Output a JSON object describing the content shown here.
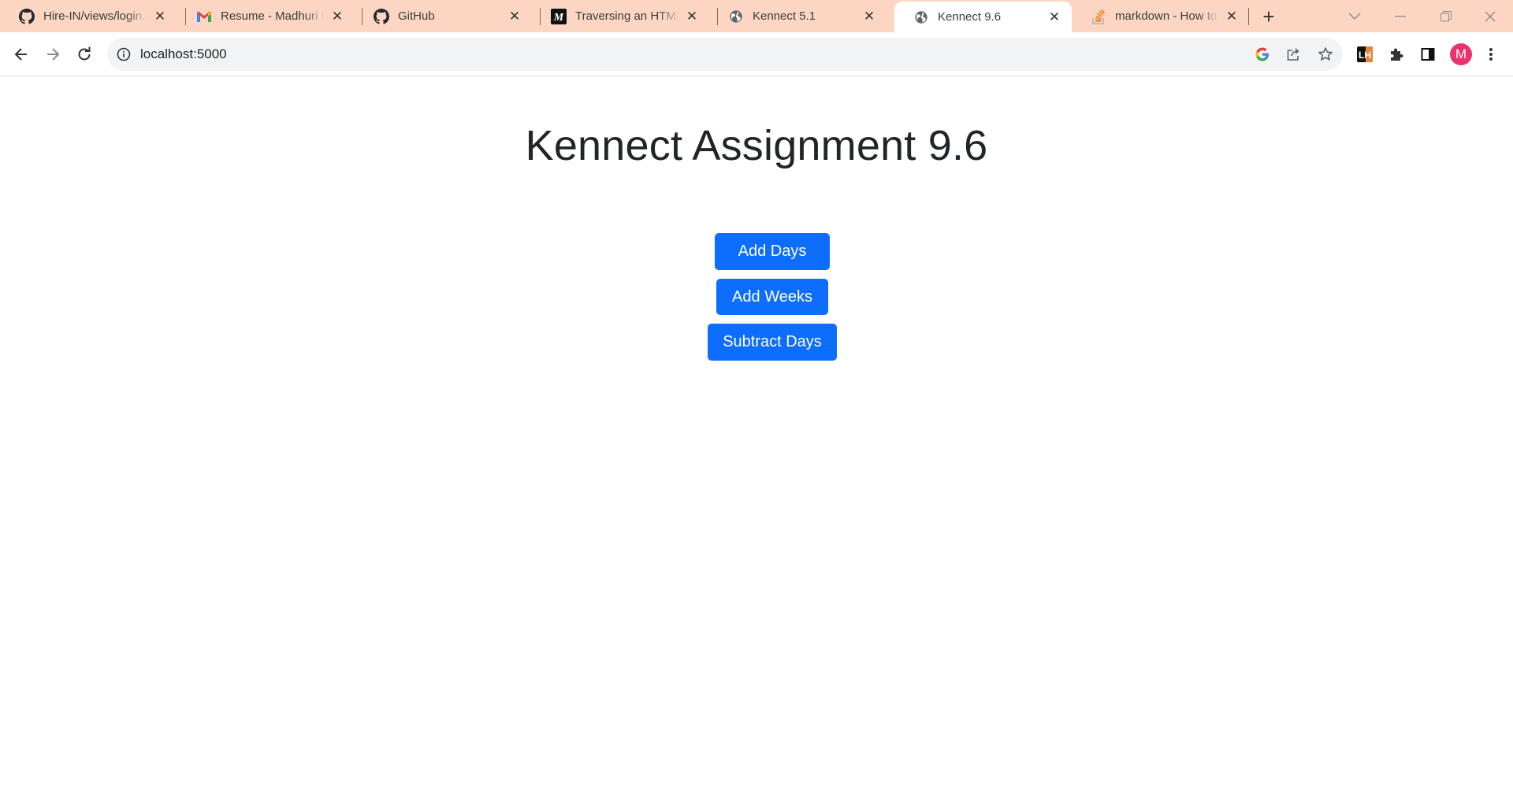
{
  "browser": {
    "tabs": [
      {
        "title": "Hire-IN/views/login.ejs",
        "favicon": "github-icon",
        "active": false
      },
      {
        "title": "Resume - Madhuri Ra",
        "favicon": "gmail-icon",
        "active": false
      },
      {
        "title": "GitHub",
        "favicon": "github-icon",
        "active": false
      },
      {
        "title": "Traversing an HTML ta",
        "favicon": "medium-icon",
        "active": false
      },
      {
        "title": "Kennect 5.1",
        "favicon": "globe-icon",
        "active": false
      },
      {
        "title": "Kennect 9.6",
        "favicon": "globe-icon",
        "active": true
      },
      {
        "title": "markdown - How to a",
        "favicon": "stackoverflow-icon",
        "active": false
      }
    ],
    "address_bar": {
      "url": "localhost:5000"
    },
    "profile_initial": "M",
    "extension_label": "LH",
    "colors": {
      "tabstrip": "#fcd6c3",
      "profile": "#e8336d"
    }
  },
  "page": {
    "title": "Kennect Assignment 9.6",
    "buttons": {
      "add_days": "Add Days",
      "add_weeks": "Add Weeks",
      "subtract_days": "Subtract Days"
    },
    "colors": {
      "button": "#0d6efd",
      "heading": "#212529"
    }
  }
}
